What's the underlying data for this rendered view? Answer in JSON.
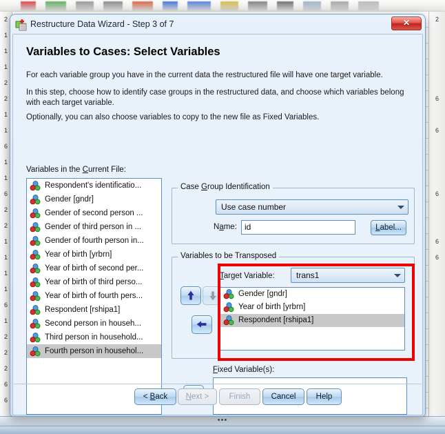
{
  "window": {
    "title": "Restructure Data Wizard - Step 3 of 7",
    "icon": "restructure-wizard-icon",
    "close_label": "Close"
  },
  "page": {
    "title": "Variables to Cases: Select Variables",
    "paragraphs": [
      "For each variable group you have in the current data the restructured file will have one target variable.",
      "In this step, choose how to identify case groups in the restructured data, and choose which variables belong with each target variable.",
      "Optionally, you can also choose variables to copy to the new file as Fixed Variables."
    ]
  },
  "source_list": {
    "label": "Variables in the Current File:",
    "items": [
      {
        "text": "Respondent's identificatio...",
        "selected": false
      },
      {
        "text": "Gender [gndr]",
        "selected": false
      },
      {
        "text": "Gender of second person ...",
        "selected": false
      },
      {
        "text": "Gender of third person in ...",
        "selected": false
      },
      {
        "text": "Gender of fourth person in...",
        "selected": false
      },
      {
        "text": "Year of birth [yrbrn]",
        "selected": false
      },
      {
        "text": "Year of birth of second per...",
        "selected": false
      },
      {
        "text": "Year of birth of third perso...",
        "selected": false
      },
      {
        "text": "Year of birth of fourth pers...",
        "selected": false
      },
      {
        "text": "Respondent [rshipa1]",
        "selected": false
      },
      {
        "text": "Second person in househ...",
        "selected": false
      },
      {
        "text": "Third person in household...",
        "selected": false
      },
      {
        "text": "Fourth person in househol...",
        "selected": true
      }
    ]
  },
  "case_group": {
    "legend": "Case Group Identification",
    "method_value": "Use case number",
    "name_label": "Name:",
    "name_value": "id",
    "label_button": "Label..."
  },
  "transposed": {
    "legend": "Variables to be Transposed",
    "target_label": "Target Variable:",
    "target_value": "trans1",
    "items": [
      {
        "text": "Gender [gndr]",
        "selected": false
      },
      {
        "text": "Year of birth [yrbrn]",
        "selected": false
      },
      {
        "text": "Respondent [rshipa1]",
        "selected": true
      }
    ],
    "move_up_icon": "arrow-up-icon",
    "move_down_icon": "arrow-down-icon",
    "move_in_icon": "arrow-left-icon"
  },
  "fixed": {
    "label": "Fixed Variable(s):",
    "items": [],
    "move_icon": "arrow-right-icon"
  },
  "footer": {
    "back": "< Back",
    "next": "Next >",
    "finish": "Finish",
    "cancel": "Cancel",
    "help": "Help",
    "next_enabled": false,
    "finish_enabled": false
  },
  "highlight": {
    "color": "#ee0000",
    "target": "variables-to-be-transposed-panel"
  },
  "background": {
    "row_header_values_left": [
      "2",
      "1",
      "1",
      "1",
      "2",
      "2",
      "1",
      "1",
      "6",
      "1",
      "1",
      "6",
      "2",
      "2",
      "1",
      "1",
      "1",
      "1",
      "6",
      "1",
      "2",
      "2",
      "2",
      "6",
      "6"
    ],
    "row_header_values_right": [
      "2",
      "",
      "",
      "",
      "",
      "6",
      "",
      "6",
      "",
      "",
      "",
      "6",
      "",
      "",
      "6",
      "6"
    ],
    "task_dots": "•••"
  },
  "colors": {
    "dialog_bg": "#e9f1fa",
    "accent_border": "#5a8fc0",
    "selection_gray": "#c8c8c8",
    "highlight_red": "#ee0000",
    "title_text": "#16243a"
  }
}
